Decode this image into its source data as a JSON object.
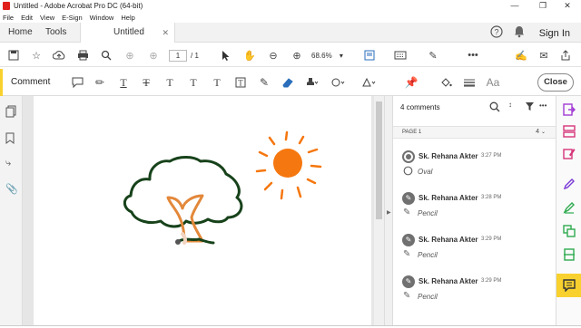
{
  "window": {
    "title": "Untitled - Adobe Acrobat Pro DC (64-bit)"
  },
  "menu": [
    "File",
    "Edit",
    "View",
    "E-Sign",
    "Window",
    "Help"
  ],
  "tabs": {
    "home": "Home",
    "tools": "Tools",
    "document": "Untitled",
    "sign_in": "Sign In"
  },
  "toolbar": {
    "page_current": "1",
    "page_total": "/ 1",
    "zoom": "68.6%"
  },
  "comment_bar": {
    "label": "Comment",
    "close": "Close",
    "text_tool_glyph": "T",
    "font_glyph": "Aa"
  },
  "panel": {
    "count": "4 comments",
    "page_label": "PAGE 1",
    "page_count": "4",
    "comments": [
      {
        "author": "Sk. Rehana Akter",
        "time": "3:27 PM",
        "type": "Oval",
        "icon": "circle-outline-icon"
      },
      {
        "author": "Sk. Rehana Akter",
        "time": "3:28 PM",
        "type": "Pencil",
        "icon": "pencil-icon"
      },
      {
        "author": "Sk. Rehana Akter",
        "time": "3:29 PM",
        "type": "Pencil",
        "icon": "pencil-icon"
      },
      {
        "author": "Sk. Rehana Akter",
        "time": "3:29 PM",
        "type": "Pencil",
        "icon": "pencil-icon"
      }
    ]
  },
  "colors": {
    "accent_yellow": "#f9d12f",
    "tree_green": "#17421a",
    "trunk_orange": "#e3883a",
    "sun_orange": "#f5770f",
    "acrobat_red": "#e0201b"
  }
}
